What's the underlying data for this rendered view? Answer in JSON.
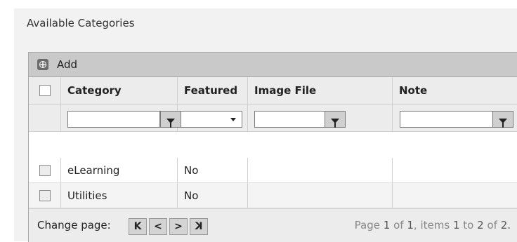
{
  "section_title": "Available Categories",
  "toolbar": {
    "add_label": "Add",
    "add_icon": "add-circle-icon"
  },
  "columns": [
    "Category",
    "Featured",
    "Image File",
    "Note"
  ],
  "filters": {
    "icon": "funnel-filter-icon",
    "featured_select_value": ""
  },
  "rows": [
    {
      "category": "eLearning",
      "featured": "No",
      "image_file": "",
      "note": ""
    },
    {
      "category": "Utilities",
      "featured": "No",
      "image_file": "",
      "note": ""
    }
  ],
  "pager": {
    "label": "Change page:",
    "buttons": [
      "K",
      "<",
      ">",
      "K"
    ],
    "info_prefix": "Page",
    "page": "1",
    "of_text": "of",
    "total_pages": "1",
    "items_text": ", items",
    "range_start": "1",
    "to_text": "to",
    "range_end": "2",
    "of_text_2": "of",
    "total_items": "2."
  }
}
